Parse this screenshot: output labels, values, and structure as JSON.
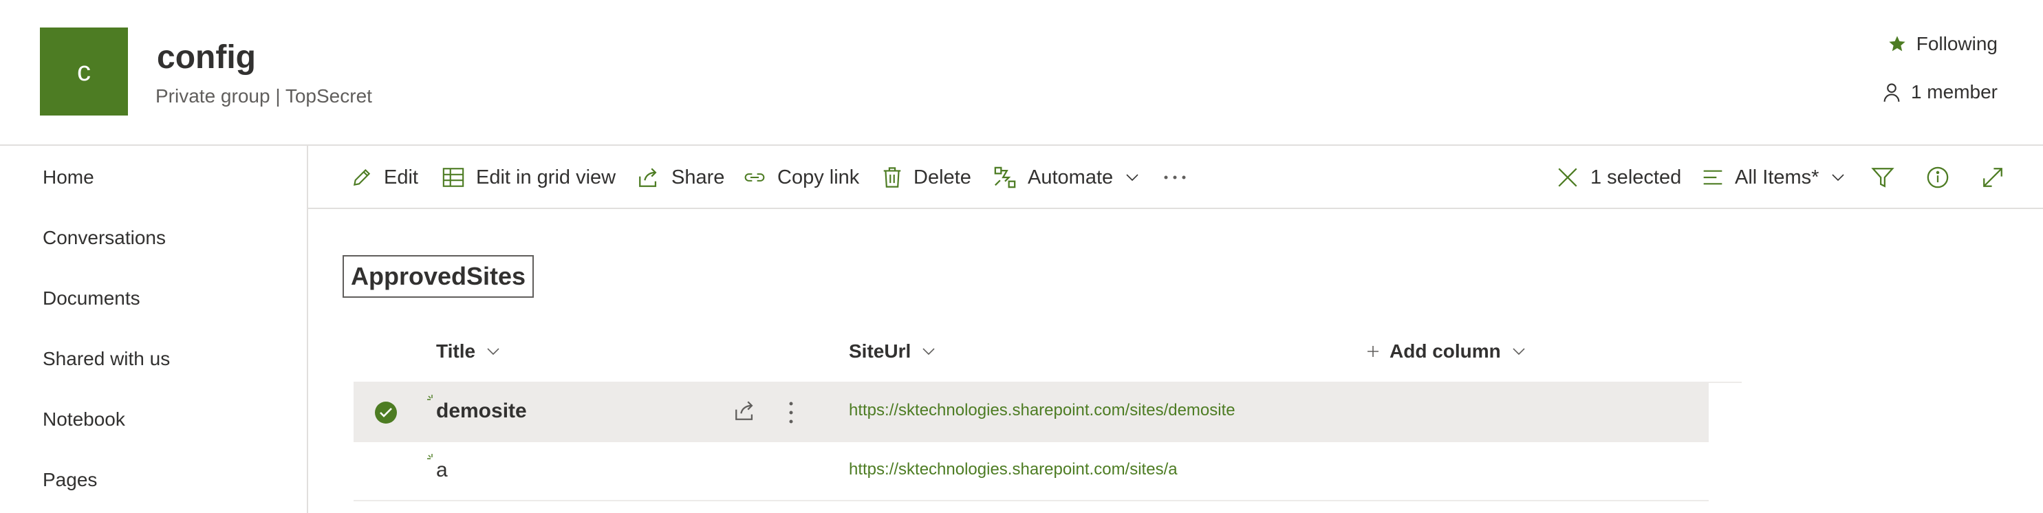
{
  "header": {
    "logo_letter": "c",
    "title": "config",
    "subtitle": "Private group | TopSecret",
    "follow_label": "Following",
    "members_label": "1 member"
  },
  "nav": {
    "items": [
      "Home",
      "Conversations",
      "Documents",
      "Shared with us",
      "Notebook",
      "Pages"
    ]
  },
  "command_bar": {
    "edit": "Edit",
    "edit_grid": "Edit in grid view",
    "share": "Share",
    "copy_link": "Copy link",
    "delete": "Delete",
    "automate": "Automate",
    "selected": "1 selected",
    "view": "All Items*"
  },
  "list": {
    "title": "ApprovedSites",
    "columns": {
      "title": "Title",
      "siteurl": "SiteUrl",
      "add_column": "Add column"
    },
    "rows": [
      {
        "title": "demosite",
        "url": "https://sktechnologies.sharepoint.com/sites/demosite",
        "selected": true
      },
      {
        "title": "a",
        "url": "https://sktechnologies.sharepoint.com/sites/a",
        "selected": false
      }
    ]
  },
  "colors": {
    "accent": "#4d7c23",
    "text": "#323130",
    "selected_row": "#edebe9"
  },
  "icons": [
    "star-icon",
    "person-icon",
    "edit-icon",
    "grid-icon",
    "share-icon",
    "link-icon",
    "delete-icon",
    "automate-icon",
    "chevron-down-icon",
    "more-icon",
    "close-icon",
    "view-lines-icon",
    "filter-icon",
    "info-icon",
    "expand-icon",
    "check-circle-icon"
  ]
}
